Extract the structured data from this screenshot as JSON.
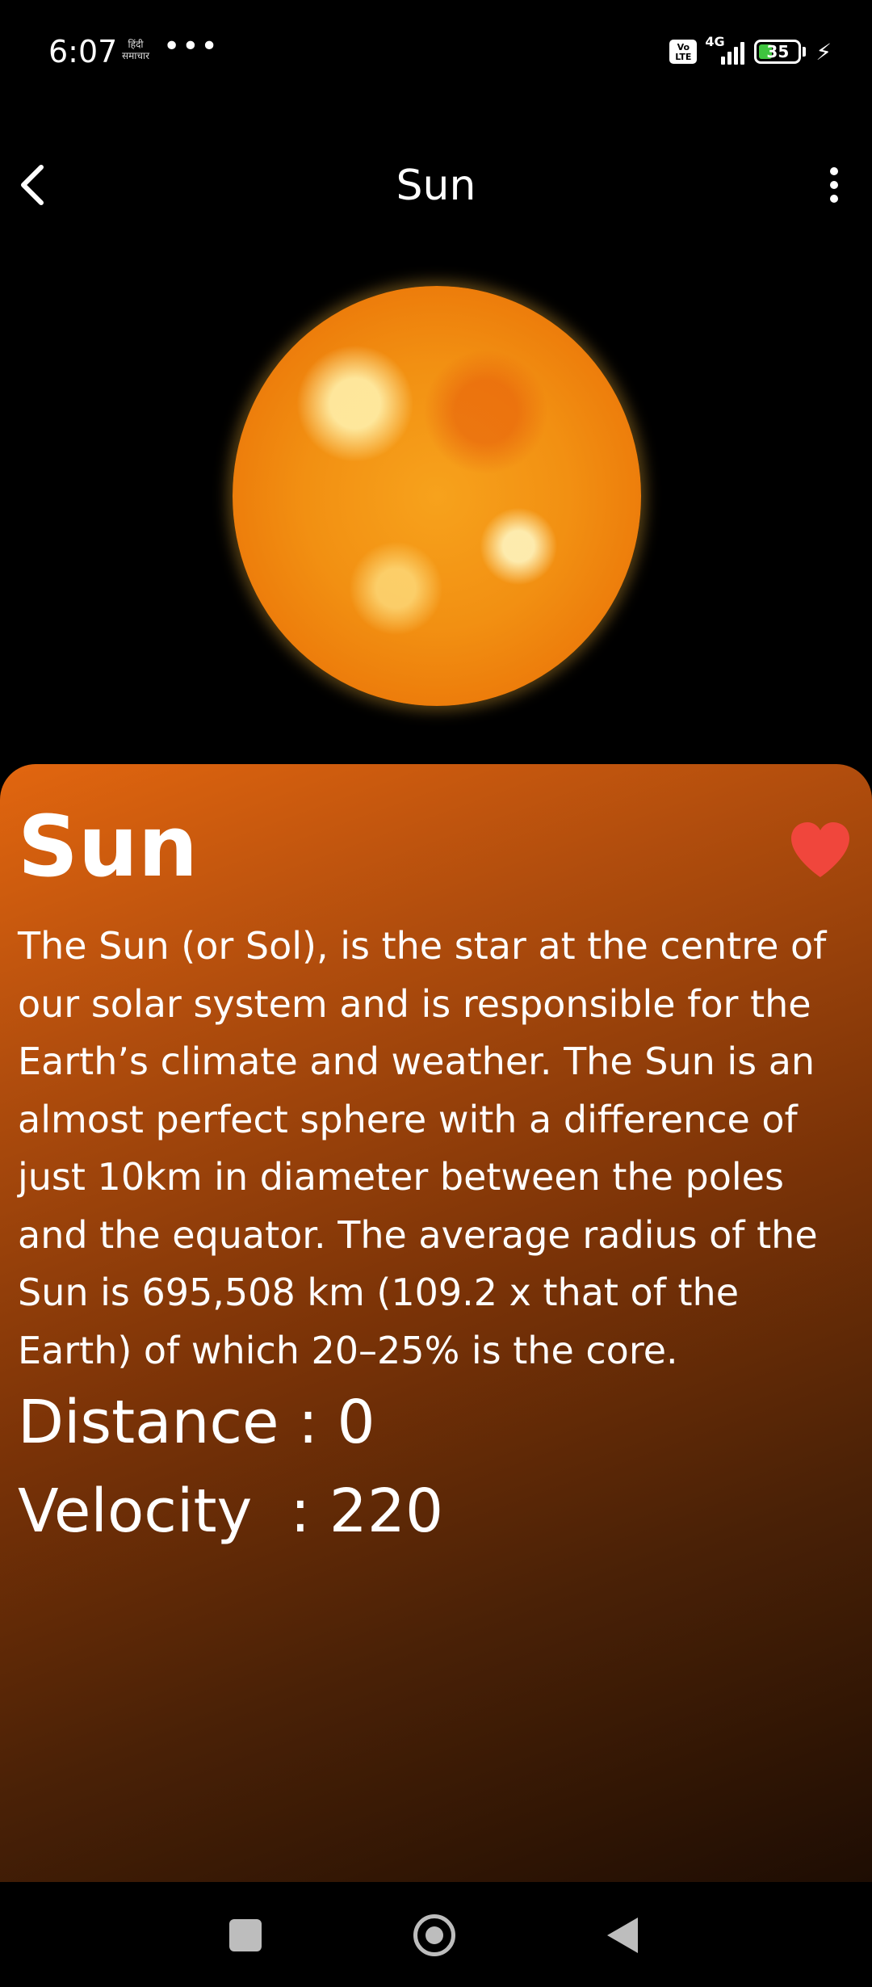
{
  "status_bar": {
    "time": "6:07",
    "notification_icon_text": "हिंदी\nसमाचार",
    "more_indicator": "•••",
    "volte_label": "Vo\nLTE",
    "network_type": "4G",
    "battery_percent": "35",
    "charging": true
  },
  "app_bar": {
    "title": "Sun",
    "back_icon": "chevron-left-icon",
    "menu_icon": "more-vertical-icon"
  },
  "hero_image": {
    "subject": "sun-image"
  },
  "card": {
    "title": "Sun",
    "favorite_icon": "heart-icon",
    "favorite_color": "#f0463c",
    "description": "The Sun (or Sol), is the star at the centre of our solar system and is responsible for the Earth’s climate and weather. The Sun is an almost perfect sphere with a difference of just 10km in diameter between the poles and the equator. The average radius of the Sun is 695,508 km (109.2 x that of the Earth) of which 20–25% is the core.",
    "distance_line": "Distance : 0",
    "velocity_line": "Velocity  : 220"
  },
  "nav_bar": {
    "recents_icon": "square-icon",
    "home_icon": "circle-icon",
    "back_icon": "triangle-back-icon"
  }
}
